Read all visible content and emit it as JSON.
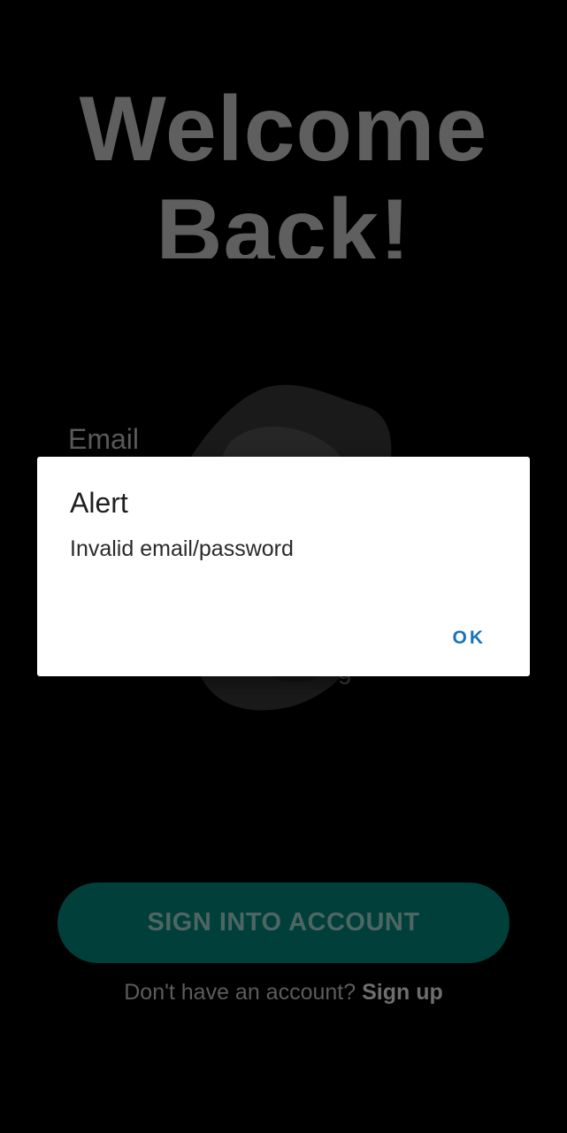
{
  "screen": {
    "title_line1": "Welcome",
    "title_line2": "Back!",
    "email_label": "Email",
    "hint_fragment": "g",
    "signin_button": "SIGN INTO ACCOUNT",
    "signup_prompt": "Don't have an account?",
    "signup_link": "Sign up"
  },
  "dialog": {
    "title": "Alert",
    "message": "Invalid email/password",
    "ok_label": "OK"
  },
  "colors": {
    "background": "#000000",
    "button_bg": "#013f3a",
    "dialog_bg": "#ffffff",
    "ok_text": "#1a73b8"
  },
  "icons": {
    "illustration": "dark-rock-illustration"
  }
}
